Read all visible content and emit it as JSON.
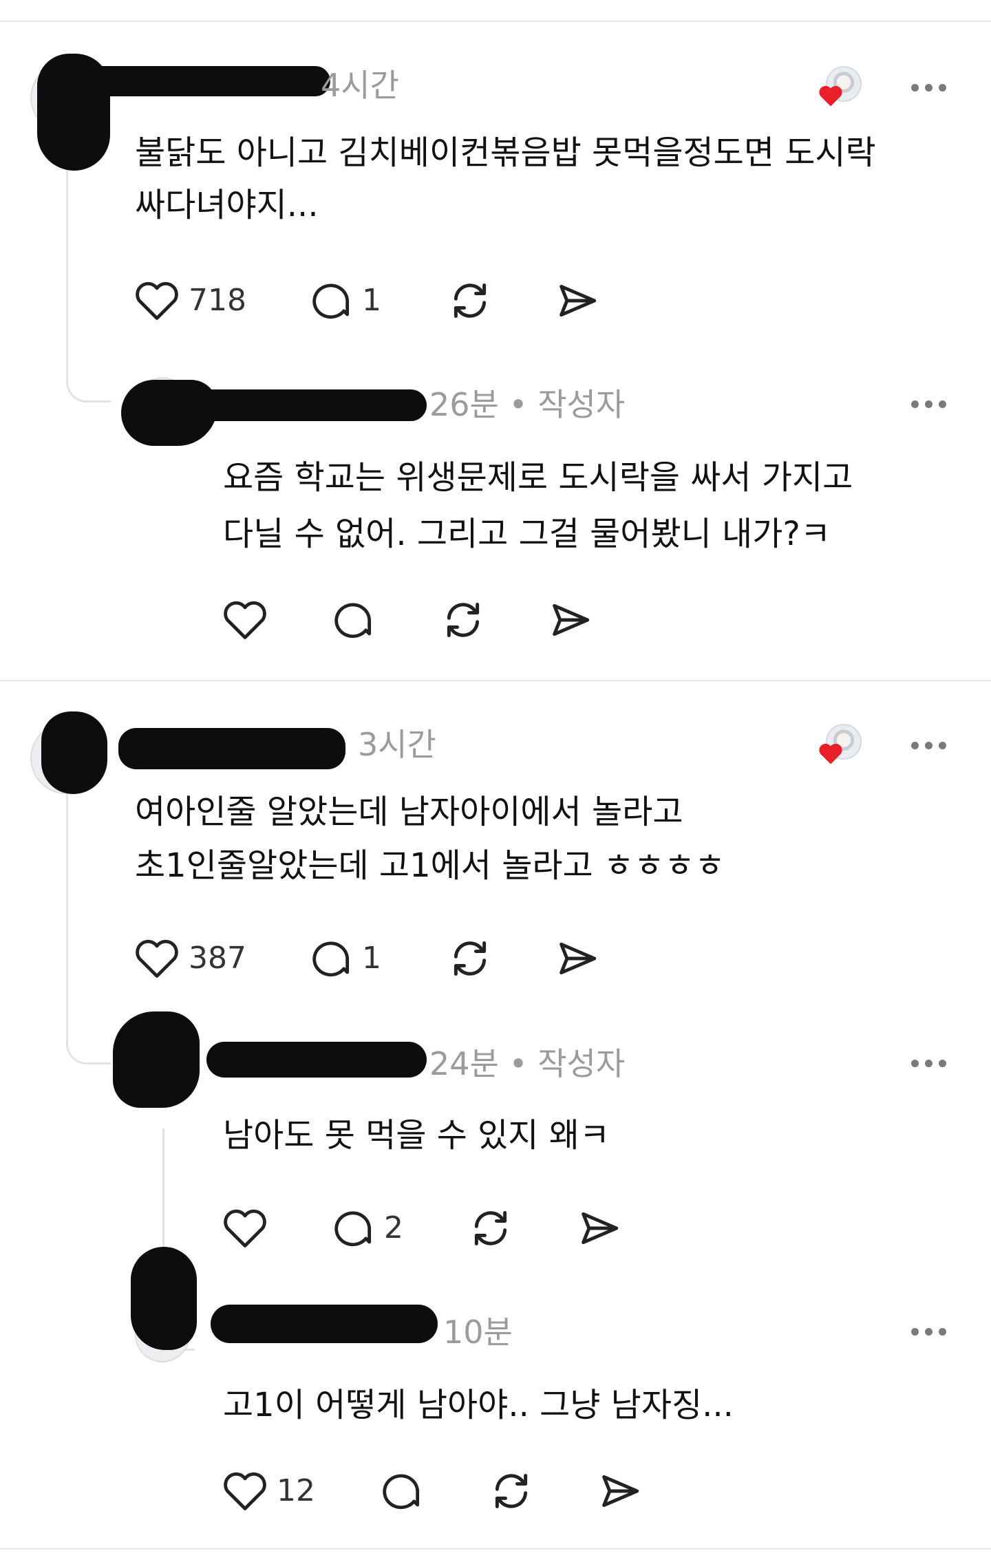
{
  "comments": [
    {
      "time": "4시간",
      "text_line1": "불닭도 아니고 김치베이컨볶음밥 못먹을정도면 도시락",
      "text_line2": "싸다녀야지...",
      "likes": "718",
      "replies": "1"
    },
    {
      "time": "26분 • 작성자",
      "text_line1": "요즘 학교는 위생문제로 도시락을 싸서 가지고",
      "text_line2": "다닐 수 없어. 그리고 그걸 물어봤니 내가?ㅋ",
      "likes": "",
      "replies": ""
    },
    {
      "time": "3시간",
      "text_line1": "여아인줄 알았는데 남자아이에서 놀라고",
      "text_line2": "초1인줄알았는데 고1에서 놀라고 ㅎㅎㅎㅎ",
      "likes": "387",
      "replies": "1"
    },
    {
      "time": "24분 • 작성자",
      "text_line1": "남아도 못 먹을 수 있지 왜ㅋ",
      "likes": "",
      "replies": "2"
    },
    {
      "time": "10분",
      "text_line1": "고1이 어떻게 남아야.. 그냥 남자징...",
      "likes": "12",
      "replies": ""
    }
  ],
  "icons": {
    "like": "heart-icon",
    "reply": "speech-bubble-icon",
    "repost": "repost-icon",
    "share": "send-icon",
    "more": "more-icon",
    "author_like": "heart-icon"
  },
  "colors": {
    "heart_liked": "#e8202a",
    "meta_gray": "#9b9b9b",
    "text": "#111111"
  }
}
